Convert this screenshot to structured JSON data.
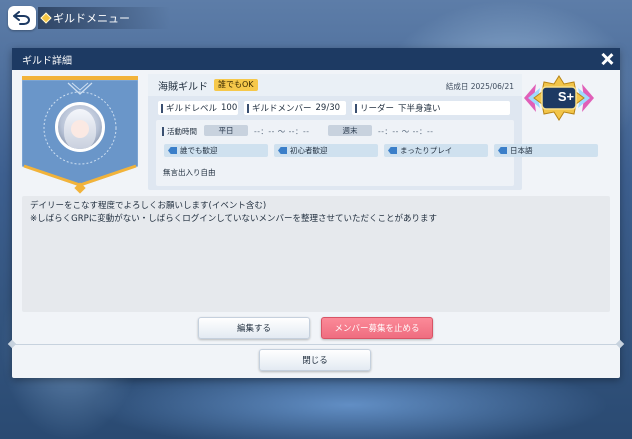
{
  "header": {
    "title": "ギルドメニュー"
  },
  "modal": {
    "title": "ギルド詳細"
  },
  "guild": {
    "name": "海賊ギルド",
    "join_badge": "誰でもOK",
    "founded_label": "結成日",
    "founded_date": "2025/06/21",
    "rank": "S+",
    "level_label": "ギルドレベル",
    "level": "100",
    "members_label": "ギルドメンバー",
    "members": "29/30",
    "leader_label": "リーダー",
    "leader": "下半身違い"
  },
  "activity": {
    "label": "活動時間",
    "weekday_label": "平日",
    "weekday_time": "--：-- 〜 --：--",
    "weekend_label": "週末",
    "weekend_time": "--：-- 〜 --：--",
    "tags": [
      "誰でも歓迎",
      "初心者歓迎",
      "まったりプレイ",
      "日本語"
    ],
    "note": "無言出入り自由"
  },
  "description": {
    "line1": "デイリーをこなす程度でよろしくお願いします(イベント含む)",
    "line2": "※しばらくGRPに変動がない・しばらくログインしていないメンバーを整理させていただくことがあります"
  },
  "buttons": {
    "edit": "編集する",
    "stop_recruit": "メンバー募集を止める",
    "close": "閉じる"
  },
  "colors": {
    "header_bg": "#1d3a63",
    "accent_gold": "#f2b33a",
    "emblem_blue": "#6a96c9",
    "stop_button": "#ef6d80"
  }
}
